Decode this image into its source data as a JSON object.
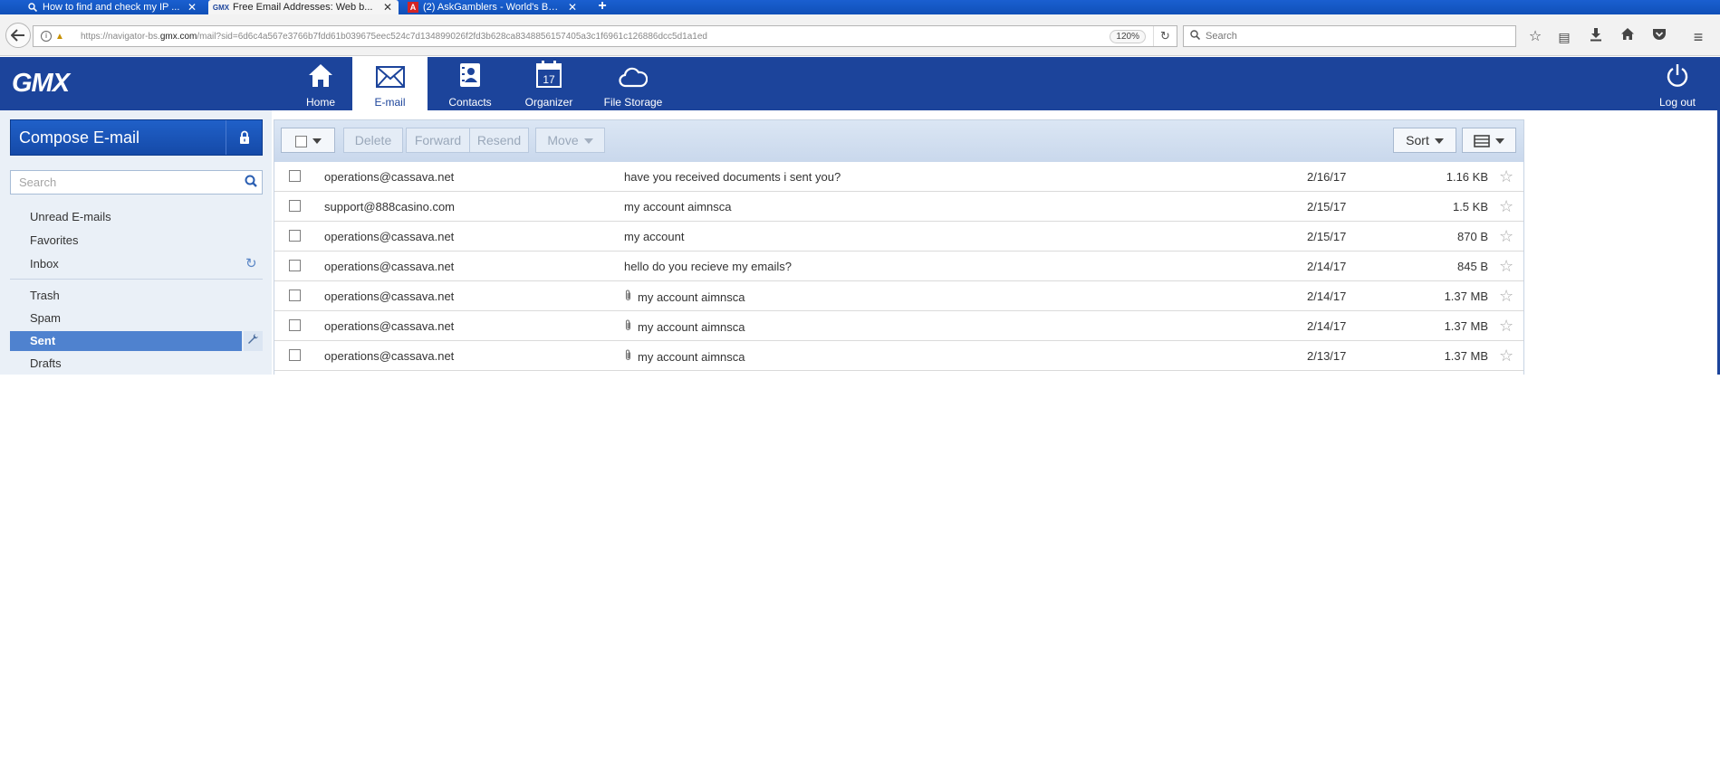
{
  "browser": {
    "tabs": [
      {
        "title": "How to find and check my IP ...",
        "icon": "search-icon",
        "active": false
      },
      {
        "title": "Free Email Addresses: Web b...",
        "icon": "gmx-favicon",
        "active": true
      },
      {
        "title": "(2) AskGamblers - World's Bes...",
        "icon": "askgamblers-favicon",
        "active": false
      }
    ],
    "url_prefix": "https://navigator-bs.",
    "url_domain": "gmx.com",
    "url_rest": "/mail?sid=6d6c4a567e3766b7fdd61b039675eec524c7d134899026f2fd3b628ca8348856157405a3c1f6961c126886dcc5d1a1ed",
    "zoom": "120%",
    "search_placeholder": "Search"
  },
  "header": {
    "logo": "GMX",
    "nav": [
      {
        "label": "Home",
        "icon": "home-icon",
        "active": false
      },
      {
        "label": "E-mail",
        "icon": "envelope-icon",
        "active": true
      },
      {
        "label": "Contacts",
        "icon": "contacts-icon",
        "active": false
      },
      {
        "label": "Organizer",
        "icon": "calendar-icon",
        "active": false,
        "calendar_day": "17"
      },
      {
        "label": "File Storage",
        "icon": "cloud-icon",
        "active": false
      }
    ],
    "logout_label": "Log out"
  },
  "sidebar": {
    "compose_label": "Compose E-mail",
    "search_placeholder": "Search",
    "folders": [
      {
        "label": "Unread E-mails"
      },
      {
        "label": "Favorites"
      },
      {
        "label": "Inbox"
      },
      {
        "label": "Trash"
      },
      {
        "label": "Spam"
      },
      {
        "label": "Sent",
        "selected": true
      },
      {
        "label": "Drafts"
      }
    ]
  },
  "toolbar": {
    "delete_label": "Delete",
    "forward_label": "Forward",
    "resend_label": "Resend",
    "move_label": "Move",
    "sort_label": "Sort"
  },
  "emails": [
    {
      "from": "operations@cassava.net",
      "subject": "have you received documents i sent you?",
      "date": "2/16/17",
      "size": "1.16 KB",
      "attachment": false
    },
    {
      "from": "support@888casino.com",
      "subject": "my account aimnsca",
      "date": "2/15/17",
      "size": "1.5 KB",
      "attachment": false
    },
    {
      "from": "operations@cassava.net",
      "subject": "my account",
      "date": "2/15/17",
      "size": "870 B",
      "attachment": false
    },
    {
      "from": "operations@cassava.net",
      "subject": "hello do you recieve my emails?",
      "date": "2/14/17",
      "size": "845 B",
      "attachment": false
    },
    {
      "from": "operations@cassava.net",
      "subject": "my account aimnsca",
      "date": "2/14/17",
      "size": "1.37 MB",
      "attachment": true
    },
    {
      "from": "operations@cassava.net",
      "subject": "my account aimnsca",
      "date": "2/14/17",
      "size": "1.37 MB",
      "attachment": true
    },
    {
      "from": "operations@cassava.net",
      "subject": "my account aimnsca",
      "date": "2/13/17",
      "size": "1.37 MB",
      "attachment": true
    }
  ],
  "colors": {
    "header_blue": "#1c449b",
    "selected_folder": "#4f82cf",
    "sidebar_bg": "#eaf0f7"
  }
}
